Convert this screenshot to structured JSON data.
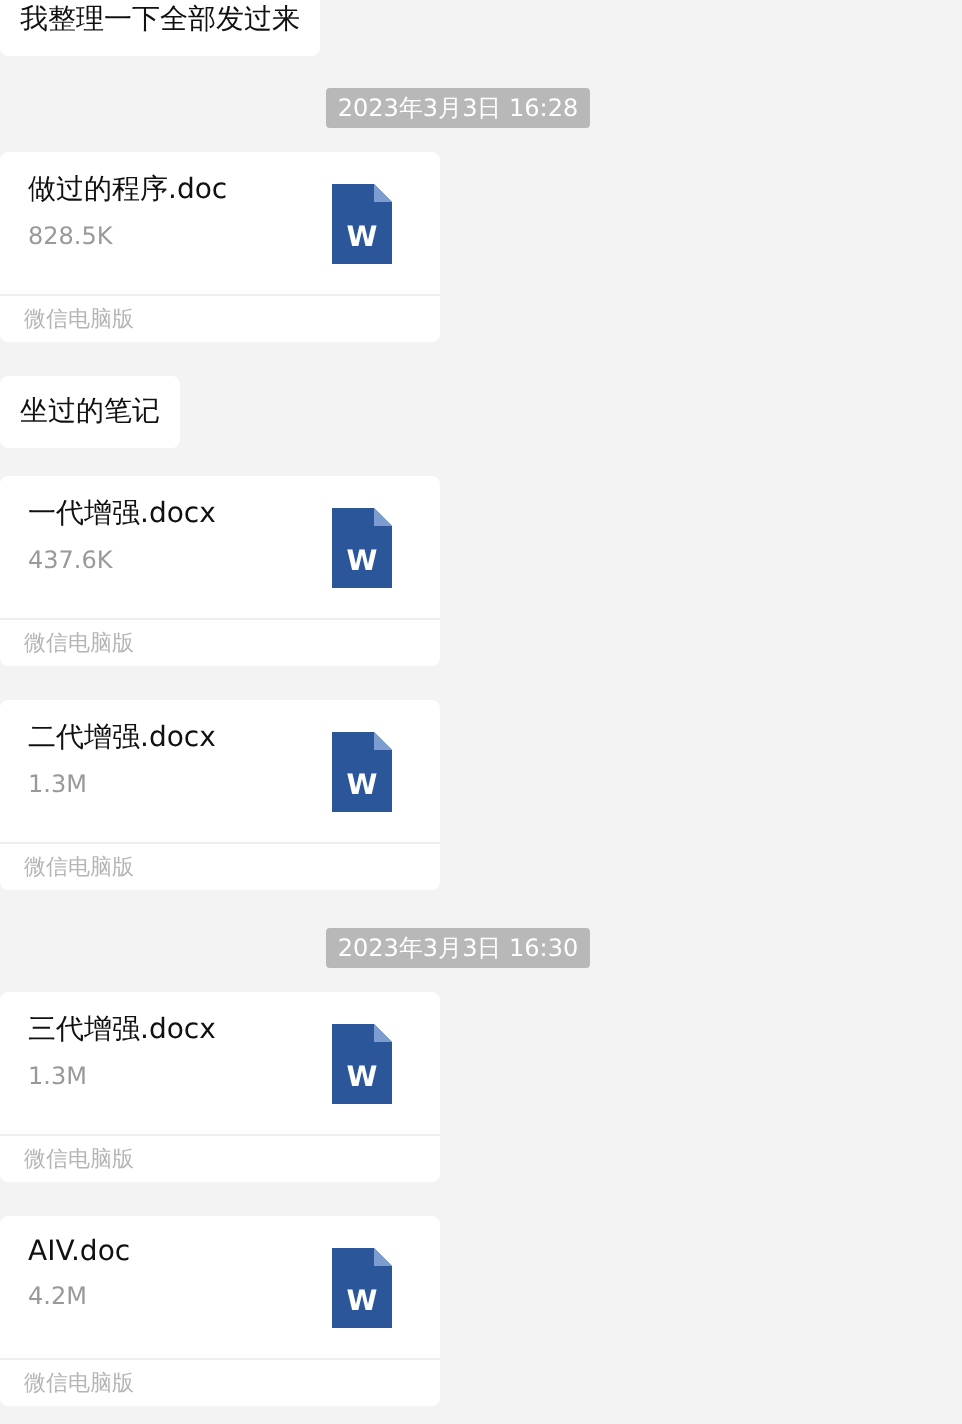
{
  "messages": [
    {
      "kind": "text",
      "text": "我整理一下全部发过来"
    },
    {
      "kind": "time",
      "text": "2023年3月3日 16:28"
    },
    {
      "kind": "file",
      "name": "做过的程序.doc",
      "size": "828.5K",
      "icon_label": "W",
      "source": "微信电脑版"
    },
    {
      "kind": "text",
      "text": "坐过的笔记"
    },
    {
      "kind": "file",
      "name": "一代增强.docx",
      "size": "437.6K",
      "icon_label": "W",
      "source": "微信电脑版"
    },
    {
      "kind": "file",
      "name": "二代增强.docx",
      "size": "1.3M",
      "icon_label": "W",
      "source": "微信电脑版"
    },
    {
      "kind": "time",
      "text": "2023年3月3日 16:30"
    },
    {
      "kind": "file",
      "name": "三代增强.docx",
      "size": "1.3M",
      "icon_label": "W",
      "source": "微信电脑版"
    },
    {
      "kind": "file",
      "name": "AIV.doc",
      "size": "4.2M",
      "icon_label": "W",
      "source": "微信电脑版"
    }
  ]
}
